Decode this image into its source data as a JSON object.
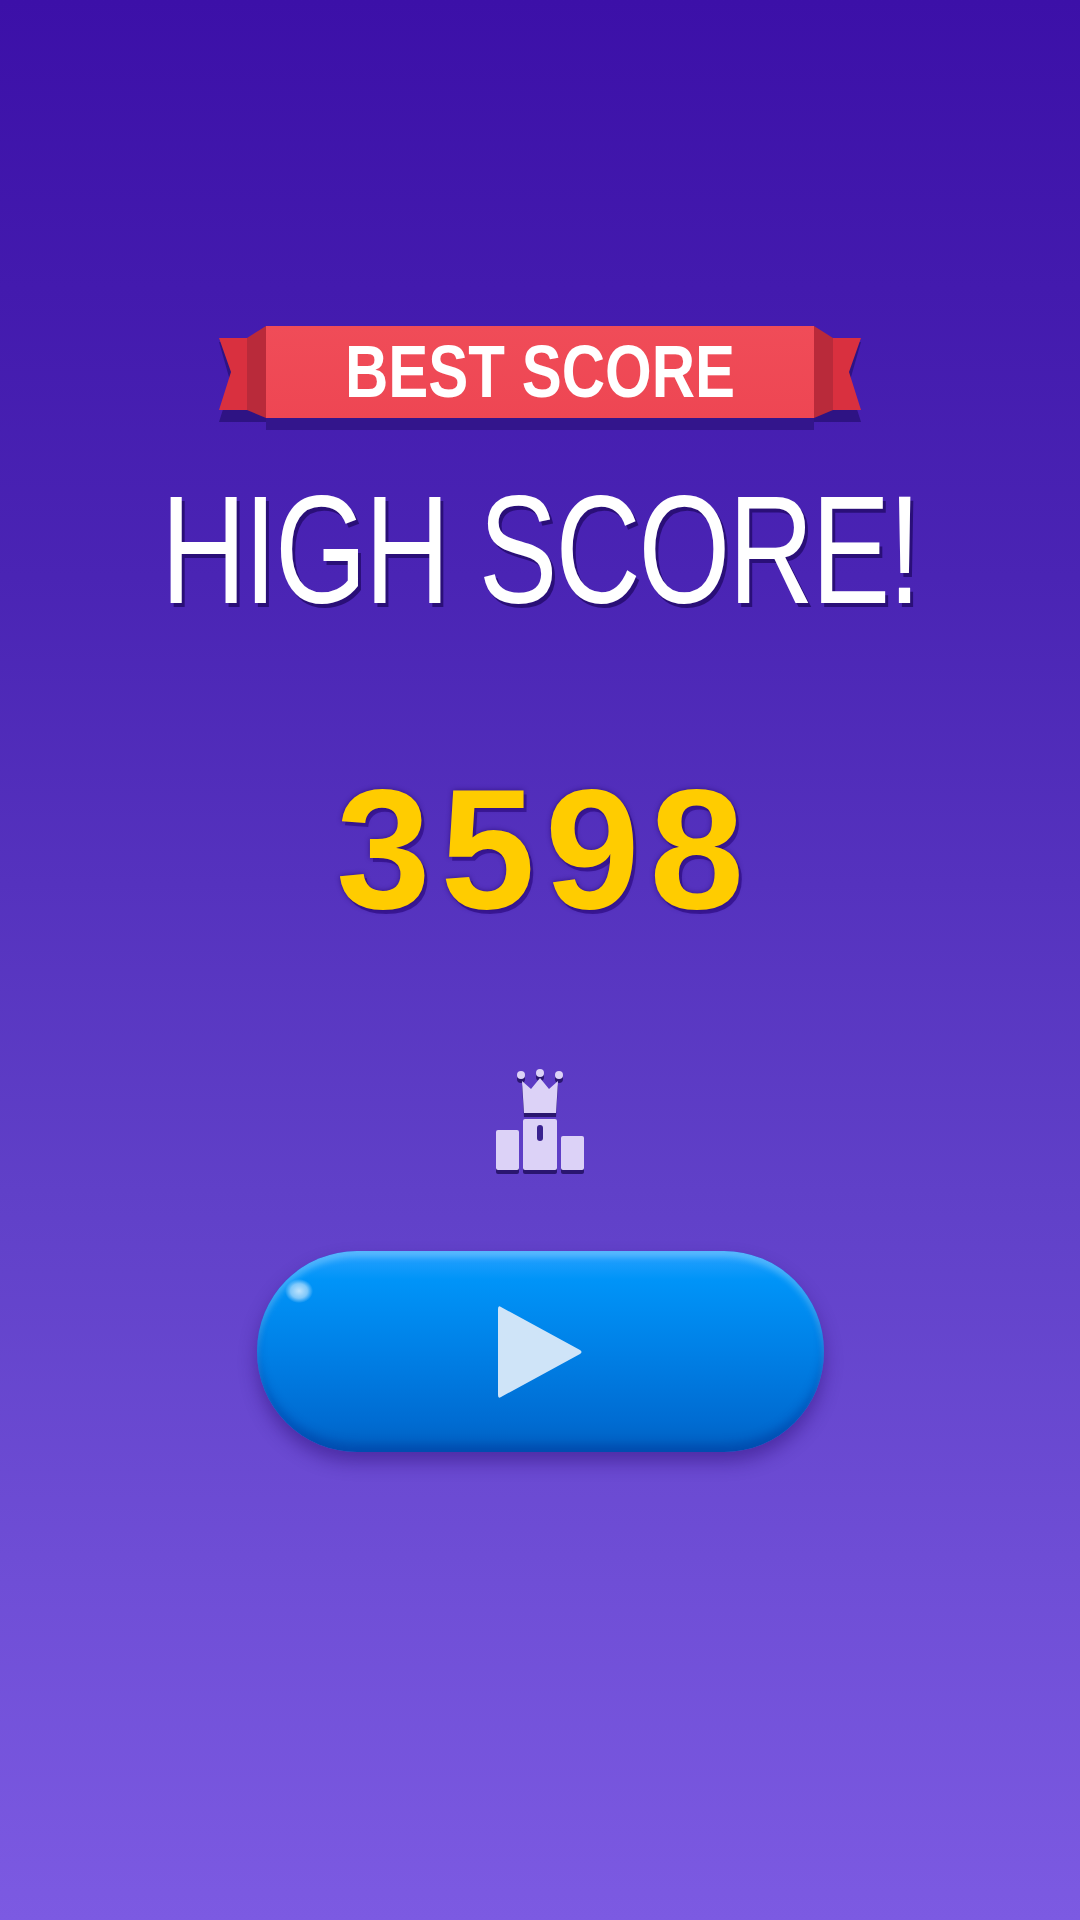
{
  "banner": {
    "label": "BEST SCORE"
  },
  "title": "HIGH SCORE!",
  "score": "3598"
}
